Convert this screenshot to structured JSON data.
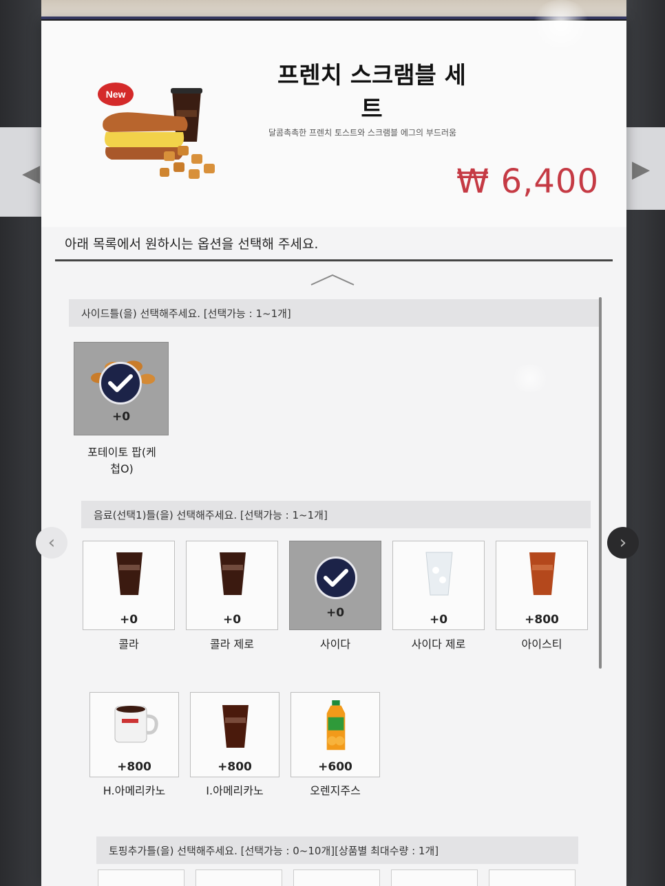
{
  "product": {
    "badge": "New",
    "title": "프렌치 스크램블 세트",
    "description": "달콤촉촉한 프렌치 토스트와 스크램블 에그의 부드러움",
    "price": "₩ 6,400"
  },
  "prompt": "아래 목록에서 원하시는 옵션을 선택해 주세요.",
  "sections": {
    "side": {
      "header": "사이드틀(을) 선택해주세요. [선택가능 : 1~1개]",
      "options": [
        {
          "label": "포테이토 팝(케\n첩O)",
          "delta": "+0",
          "selected": true,
          "icon": "potato-pop-icon"
        }
      ]
    },
    "drink": {
      "header": "음료(선택1)틀(을) 선택해주세요. [선택가능 : 1~1개]",
      "options": [
        {
          "label": "콜라",
          "delta": "+0",
          "selected": false,
          "icon": "cola-cup-icon"
        },
        {
          "label": "콜라 제로",
          "delta": "+0",
          "selected": false,
          "icon": "cola-zero-cup-icon"
        },
        {
          "label": "사이다",
          "delta": "+0",
          "selected": true,
          "icon": "cider-cup-icon"
        },
        {
          "label": "사이다 제로",
          "delta": "+0",
          "selected": false,
          "icon": "cider-zero-cup-icon"
        },
        {
          "label": "아이스티",
          "delta": "+800",
          "selected": false,
          "icon": "iced-tea-cup-icon"
        },
        {
          "label": "H.아메리카노",
          "delta": "+800",
          "selected": false,
          "icon": "hot-americano-mug-icon"
        },
        {
          "label": "I.아메리카노",
          "delta": "+800",
          "selected": false,
          "icon": "iced-americano-cup-icon"
        },
        {
          "label": "오렌지주스",
          "delta": "+600",
          "selected": false,
          "icon": "orange-juice-bottle-icon"
        }
      ]
    },
    "topping": {
      "header": "토핑추가틀(을) 선택해주세요. [선택가능 : 0~10개][상품별 최대수량 : 1개]"
    }
  },
  "colors": {
    "price": "#c53a44",
    "badge": "#d42a2a",
    "check_bg": "#1c2348",
    "selected_tile": "#a2a2a2"
  }
}
